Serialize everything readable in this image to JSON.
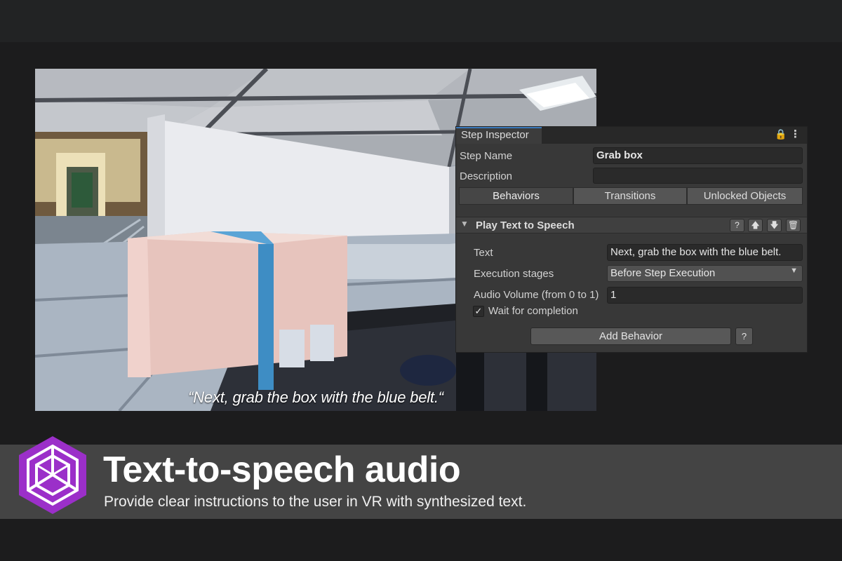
{
  "scene": {
    "subtitle": "“Next, grab the box with the blue belt.“"
  },
  "inspector": {
    "tab_title": "Step Inspector",
    "lock_icon": "lock-icon",
    "menu_icon": "kebab-menu-icon",
    "step_name_label": "Step Name",
    "step_name_value": "Grab box",
    "description_label": "Description",
    "description_value": "",
    "tabs": [
      {
        "label": "Behaviors",
        "active": true
      },
      {
        "label": "Transitions",
        "active": false
      },
      {
        "label": "Unlocked Objects",
        "active": false
      }
    ],
    "behavior": {
      "title": "Play Text to Speech",
      "buttons": [
        "?",
        "▲",
        "▼",
        "🗑"
      ],
      "text_label": "Text",
      "text_value": "Next, grab the box with the blue belt.",
      "execution_label": "Execution stages",
      "execution_value": "Before Step Execution",
      "volume_label": "Audio Volume (from 0 to 1)",
      "volume_value": "1",
      "wait_label": "Wait for completion",
      "wait_checked": true
    },
    "add_behavior_label": "Add Behavior",
    "help_label": "?"
  },
  "banner": {
    "title": "Text-to-speech audio",
    "subtitle": "Provide clear instructions to the user in VR with synthesized text.",
    "logo_icon": "hexagon-cube-logo-icon",
    "logo_color": "#9b2fc9"
  }
}
